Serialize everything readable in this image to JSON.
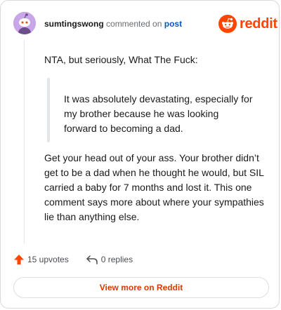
{
  "header": {
    "username": "sumtingswong",
    "commented_on": "commented on",
    "post_link": "post",
    "brand": "reddit"
  },
  "comment": {
    "intro": "NTA, but seriously, What The Fuck:",
    "quote": "It was absolutely devastating, especially for my brother because he was looking forward to becoming a dad.",
    "reply": "Get your head out of your ass. Your brother didn’t get to be a dad when he thought he would, but SIL carried a baby for 7 months and lost it. This one comment says more about where your sympathies lie than anything else."
  },
  "actions": {
    "upvotes": "15 upvotes",
    "replies": "0 replies"
  },
  "footer": {
    "view_more": "View more on Reddit"
  },
  "colors": {
    "brand_orange": "#ff4500",
    "link_blue": "#0b56c2",
    "avatar_bg": "#c9a6e8"
  },
  "icons": {
    "avatar": "snoo-avatar-icon",
    "logo": "reddit-logo-icon",
    "upvote": "upvote-arrow-icon",
    "reply": "reply-arrow-icon"
  }
}
